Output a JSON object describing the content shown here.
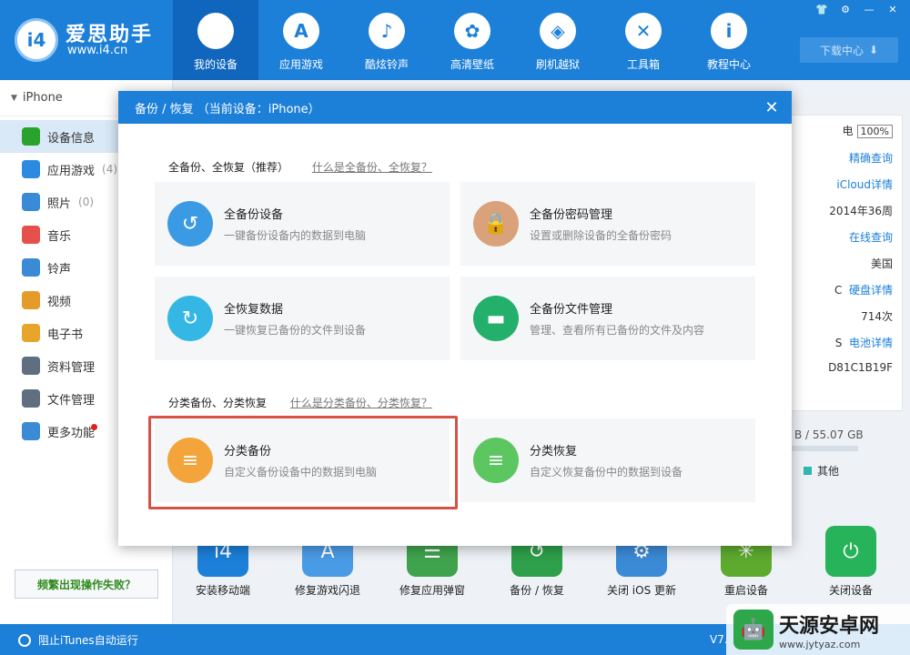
{
  "app": {
    "name": "爱思助手",
    "url": "www.i4.cn",
    "logo_text": "i4",
    "download_center": "下载中心"
  },
  "nav": [
    {
      "label": "我的设备",
      "icon": "apple-icon",
      "glyph": "",
      "active": true
    },
    {
      "label": "应用游戏",
      "icon": "app-store-icon",
      "glyph": "A"
    },
    {
      "label": "酷炫铃声",
      "icon": "bell-icon",
      "glyph": "♪"
    },
    {
      "label": "高清壁纸",
      "icon": "flower-icon",
      "glyph": "✿"
    },
    {
      "label": "刷机越狱",
      "icon": "dropbox-icon",
      "glyph": "◈"
    },
    {
      "label": "工具箱",
      "icon": "tools-icon",
      "glyph": "✕"
    },
    {
      "label": "教程中心",
      "icon": "info-icon",
      "glyph": "i"
    }
  ],
  "sidebar": {
    "device": "iPhone",
    "items": [
      {
        "label": "设备信息",
        "icon": "info-circle-icon",
        "count": "",
        "color": "#2aa32e",
        "active": true
      },
      {
        "label": "应用游戏",
        "icon": "app-store-icon",
        "count": "(4)",
        "color": "#2d8ae0"
      },
      {
        "label": "照片",
        "icon": "photo-icon",
        "count": "(0)",
        "color": "#3b8ad6"
      },
      {
        "label": "音乐",
        "icon": "music-icon",
        "count": "",
        "color": "#e6504a"
      },
      {
        "label": "铃声",
        "icon": "bell-icon",
        "count": "",
        "color": "#3b8ad6"
      },
      {
        "label": "视频",
        "icon": "video-icon",
        "count": "",
        "color": "#e59b2a"
      },
      {
        "label": "电子书",
        "icon": "book-icon",
        "count": "",
        "color": "#e8a52c"
      },
      {
        "label": "资料管理",
        "icon": "contacts-icon",
        "count": "",
        "color": "#5f6f80"
      },
      {
        "label": "文件管理",
        "icon": "file-icon",
        "count": "",
        "color": "#5f6f80"
      },
      {
        "label": "更多功能",
        "icon": "grid-icon",
        "count": "",
        "color": "#3b8ad6"
      }
    ],
    "help_button": "频繁出现操作失败？"
  },
  "info": {
    "charging_label": "电",
    "battery": "100%",
    "exact_query": "精确查询",
    "icloud": "iCloud详情",
    "production_date": "2014年36周",
    "warranty": "在线查询",
    "region": "美国",
    "disk_label": "C",
    "disk_detail": "硬盘详情",
    "charge_count": "714次",
    "battery_label": "S",
    "battery_detail": "电池详情",
    "serial": "D81C1B19F",
    "storage": "B / 55.07 GB",
    "legend_other": "其他"
  },
  "tools": [
    {
      "label": "安装移动端",
      "icon": "i4-app-icon",
      "glyph": "i4",
      "color": "#1c7fd8"
    },
    {
      "label": "修复游戏闪退",
      "icon": "app-repair-icon",
      "glyph": "A",
      "color": "#4a9be6"
    },
    {
      "label": "修复应用弹窗",
      "icon": "app-popup-icon",
      "glyph": "☰",
      "color": "#3fa34d"
    },
    {
      "label": "备份 / 恢复",
      "icon": "backup-restore-icon",
      "glyph": "↺",
      "color": "#2e9f4a"
    },
    {
      "label": "关闭 iOS 更新",
      "icon": "ios-update-icon",
      "glyph": "⚙",
      "color": "#3b8ad6"
    },
    {
      "label": "重启设备",
      "icon": "restart-icon",
      "glyph": "✳",
      "color": "#5daa2e"
    },
    {
      "label": "关闭设备",
      "icon": "power-icon",
      "glyph": "⏻",
      "color": "#27b35a"
    }
  ],
  "statusbar": {
    "itunes_toggle": "阻止iTunes自动运行",
    "version": "V7."
  },
  "watermark": {
    "name": "天源安卓网",
    "url": "www.jytyaz.com"
  },
  "modal": {
    "title": "备份 / 恢复 （当前设备：iPhone）",
    "full_section": {
      "title": "全备份、全恢复（推荐）",
      "link": "什么是全备份、全恢复？"
    },
    "category_section": {
      "title": "分类备份、分类恢复",
      "link": "什么是分类备份、分类恢复？"
    },
    "cards": [
      {
        "title": "全备份设备",
        "desc": "一键备份设备内的数据到电脑",
        "icon": "full-backup-icon",
        "glyph": "↺",
        "color": "#3a9ae3"
      },
      {
        "title": "全备份密码管理",
        "desc": "设置或删除设备的全备份密码",
        "icon": "lock-icon",
        "glyph": "🔒",
        "color": "#d9a27a"
      },
      {
        "title": "全恢复数据",
        "desc": "一键恢复已备份的文件到设备",
        "icon": "full-restore-icon",
        "glyph": "↻",
        "color": "#35b7e6"
      },
      {
        "title": "全备份文件管理",
        "desc": "管理、查看所有已备份的文件及内容",
        "icon": "folder-icon",
        "glyph": "▬",
        "color": "#22b06b"
      },
      {
        "title": "分类备份",
        "desc": "自定义备份设备中的数据到电脑",
        "icon": "category-backup-icon",
        "glyph": "≡",
        "color": "#f3a43b"
      },
      {
        "title": "分类恢复",
        "desc": "自定义恢复备份中的数据到设备",
        "icon": "category-restore-icon",
        "glyph": "≡",
        "color": "#5cc660"
      }
    ]
  }
}
